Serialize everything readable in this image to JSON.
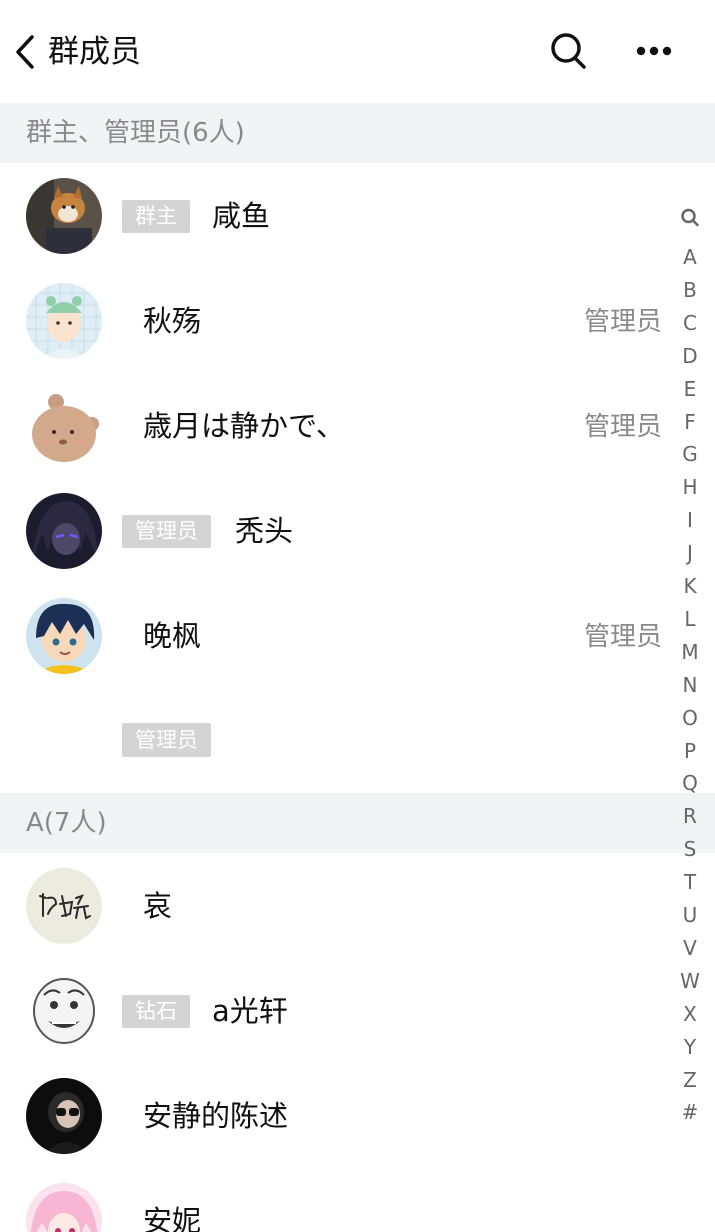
{
  "header": {
    "title": "群成员",
    "icons": {
      "back": "chevron-left-icon",
      "search": "search-icon",
      "more": "more-dots-icon"
    }
  },
  "sections": {
    "admins": {
      "label": "群主、管理员(6人)"
    },
    "a": {
      "label": "A(7人)"
    }
  },
  "admins": [
    {
      "badge": "群主",
      "name": "咸鱼",
      "role": ""
    },
    {
      "badge": "",
      "name": "秋殇",
      "role": "管理员"
    },
    {
      "badge": "",
      "name": "歳月は静かで、",
      "role": "管理员"
    },
    {
      "badge": "管理员",
      "name": "秃头",
      "role": ""
    },
    {
      "badge": "",
      "name": "晚枫",
      "role": "管理员"
    }
  ],
  "lone_badge": "管理员",
  "a_members": [
    {
      "badge": "",
      "name": "哀"
    },
    {
      "badge": "钻石",
      "name": "a光轩"
    },
    {
      "badge": "",
      "name": "安静的陈述"
    },
    {
      "badge": "",
      "name": "安妮"
    }
  ],
  "index_bar": {
    "letters": [
      "A",
      "B",
      "C",
      "D",
      "E",
      "F",
      "G",
      "H",
      "I",
      "J",
      "K",
      "L",
      "M",
      "N",
      "O",
      "P",
      "Q",
      "R",
      "S",
      "T",
      "U",
      "V",
      "W",
      "X",
      "Y",
      "Z",
      "#"
    ]
  },
  "colors": {
    "section_bg": "#f2f3f5",
    "badge_bg": "#d4d4d4",
    "muted_text": "#8a8a8a"
  }
}
